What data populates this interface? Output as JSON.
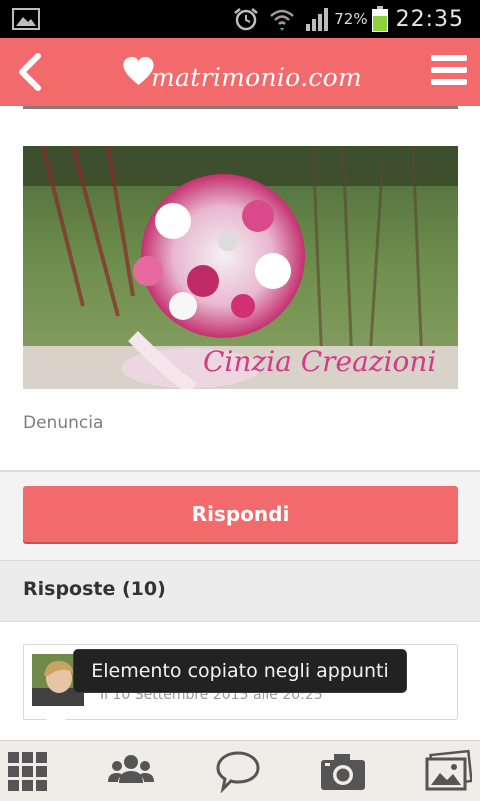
{
  "status_bar": {
    "battery_percent": "72%",
    "time": "22:35",
    "icons": [
      "gallery-icon",
      "alarm-icon",
      "wifi-icon",
      "signal-icon",
      "battery-icon"
    ]
  },
  "header": {
    "logo_text": "matrimonio.com",
    "brand_color": "#f26a6c"
  },
  "post": {
    "image_watermark": "Cinzia Creazioni",
    "report_label": "Denuncia",
    "reply_button": "Rispondi"
  },
  "answers": {
    "title": "Risposte (10)",
    "first": {
      "date": "Il 10 Settembre 2015 alle 20:25"
    }
  },
  "toast": {
    "message": "Elemento copiato negli appunti"
  },
  "bottom_nav": {
    "items": [
      "grid-icon",
      "community-icon",
      "chat-icon",
      "camera-icon",
      "photos-icon"
    ]
  }
}
